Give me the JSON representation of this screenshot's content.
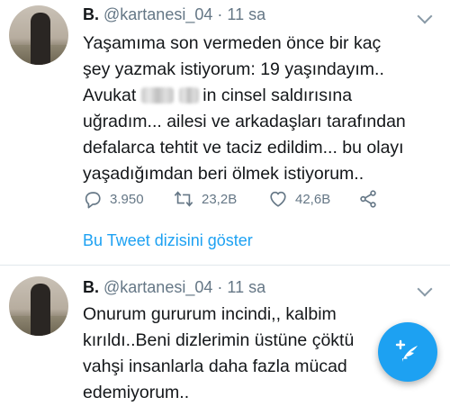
{
  "tweets": [
    {
      "name": "B.",
      "handle": "@kartanesi_04",
      "separator": "·",
      "time": "11 sa",
      "lines": [
        "Yaşamıma son vermeden önce bir kaç",
        "şey yazmak istiyorum: 19 yaşındayım..",
        {
          "before": "Avukat",
          "after": "in cinsel saldırısına"
        },
        "uğradım... ailesi ve arkadaşları tarafından",
        "defalarca tehtit ve taciz edildim... bu olayı",
        "yaşadığımdan beri ölmek istiyorum.."
      ],
      "actions": {
        "reply_count": "3.950",
        "retweet_count": "23,2B",
        "like_count": "42,6B"
      },
      "show_thread": "Bu Tweet dizisini göster"
    },
    {
      "name": "B.",
      "handle": "@kartanesi_04",
      "separator": "·",
      "time": "11 sa",
      "lines": [
        "Onurum gururum incindi,, kalbim",
        "kırıldı..Beni dizlerimin üstüne çöktü",
        "vahşi insanlarla  daha fazla mücad",
        "edemiyorum.."
      ]
    }
  ],
  "colors": {
    "accent": "#1da1f2",
    "text": "#14171a",
    "muted": "#657786",
    "divider": "#e1e8ed"
  },
  "icons": [
    "reply-icon",
    "retweet-icon",
    "like-icon",
    "share-icon",
    "compose-tweet-icon",
    "caret-down-icon"
  ]
}
